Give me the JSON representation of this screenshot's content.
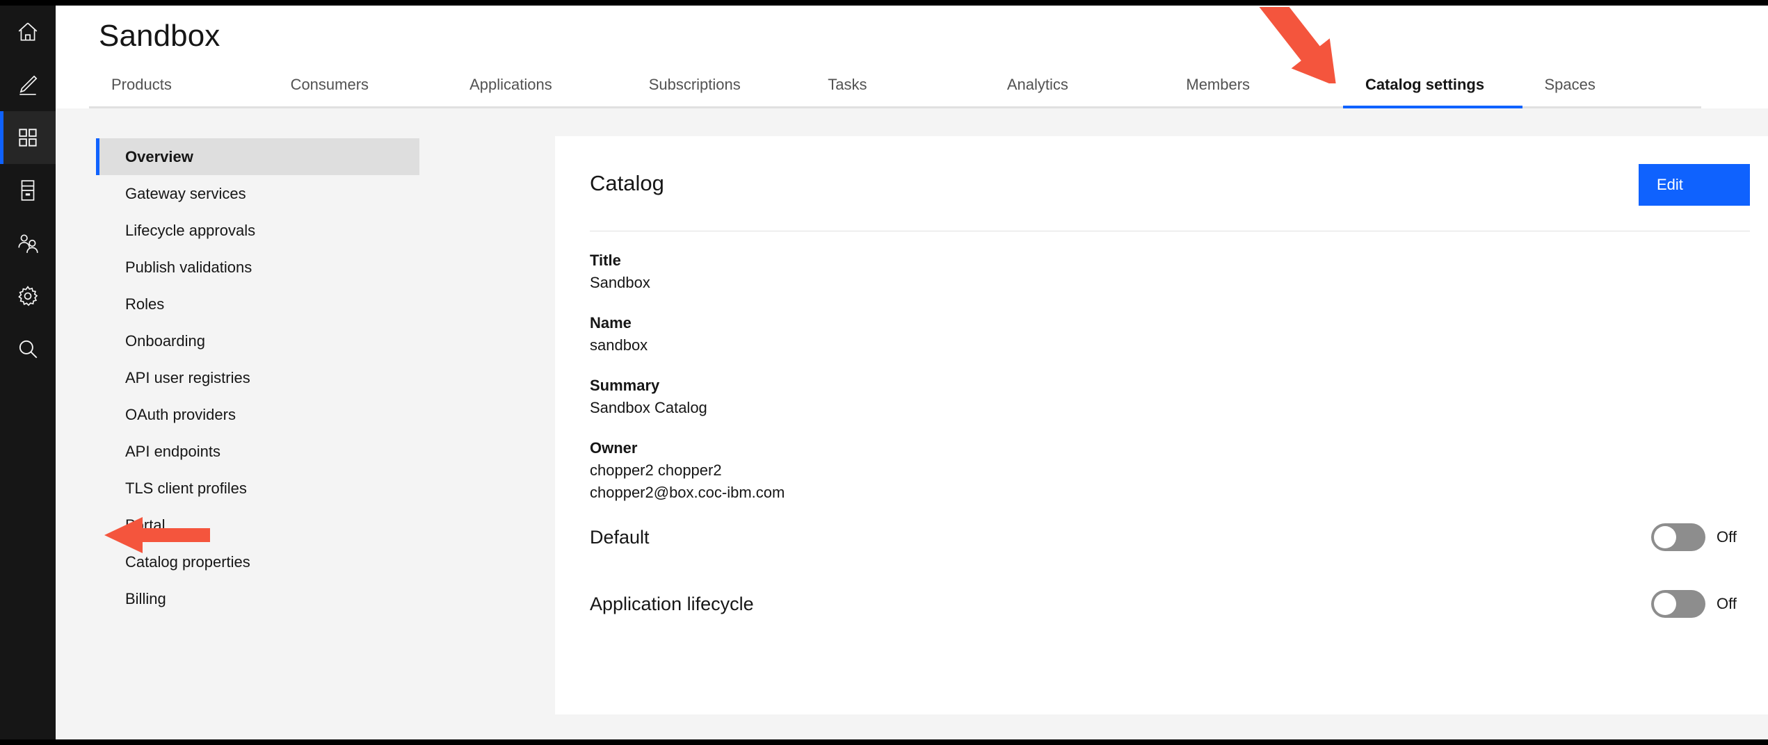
{
  "window": {
    "background_color": "#f4f4f4",
    "accent_color": "#0f62fe"
  },
  "rail": {
    "items": [
      {
        "name": "home",
        "icon": "home-icon",
        "active": false
      },
      {
        "name": "develop",
        "icon": "pencil-icon",
        "active": false
      },
      {
        "name": "manage",
        "icon": "grid-icon",
        "active": true
      },
      {
        "name": "resources",
        "icon": "server-icon",
        "active": false
      },
      {
        "name": "members",
        "icon": "users-icon",
        "active": false
      },
      {
        "name": "settings",
        "icon": "gear-icon",
        "active": false
      },
      {
        "name": "search",
        "icon": "search-icon",
        "active": false
      }
    ]
  },
  "header": {
    "title": "Sandbox"
  },
  "tabs": [
    {
      "label": "Products",
      "active": false
    },
    {
      "label": "Consumers",
      "active": false
    },
    {
      "label": "Applications",
      "active": false
    },
    {
      "label": "Subscriptions",
      "active": false
    },
    {
      "label": "Tasks",
      "active": false
    },
    {
      "label": "Analytics",
      "active": false
    },
    {
      "label": "Members",
      "active": false
    },
    {
      "label": "Catalog settings",
      "active": true
    },
    {
      "label": "Spaces",
      "active": false
    }
  ],
  "subnav": [
    {
      "label": "Overview",
      "active": true
    },
    {
      "label": "Gateway services",
      "active": false
    },
    {
      "label": "Lifecycle approvals",
      "active": false
    },
    {
      "label": "Publish validations",
      "active": false
    },
    {
      "label": "Roles",
      "active": false
    },
    {
      "label": "Onboarding",
      "active": false
    },
    {
      "label": "API user registries",
      "active": false
    },
    {
      "label": "OAuth providers",
      "active": false
    },
    {
      "label": "API endpoints",
      "active": false
    },
    {
      "label": "TLS client profiles",
      "active": false
    },
    {
      "label": "Portal",
      "active": false
    },
    {
      "label": "Catalog properties",
      "active": false
    },
    {
      "label": "Billing",
      "active": false
    }
  ],
  "panel": {
    "heading": "Catalog",
    "edit_label": "Edit",
    "fields": [
      {
        "label": "Title",
        "value": "Sandbox"
      },
      {
        "label": "Name",
        "value": "sandbox"
      },
      {
        "label": "Summary",
        "value": "Sandbox Catalog"
      },
      {
        "label": "Owner",
        "value": "chopper2 chopper2",
        "value2": "chopper2@box.coc-ibm.com"
      }
    ],
    "toggles": [
      {
        "label": "Default",
        "state": "Off",
        "on": false
      },
      {
        "label": "Application lifecycle",
        "state": "Off",
        "on": false
      }
    ]
  },
  "annotations": {
    "arrow_color": "#f4553d",
    "arrows": [
      {
        "name": "arrow-pointing-to-catalog-settings-tab",
        "target": "Catalog settings"
      },
      {
        "name": "arrow-pointing-to-portal-nav-item",
        "target": "Portal"
      }
    ]
  }
}
